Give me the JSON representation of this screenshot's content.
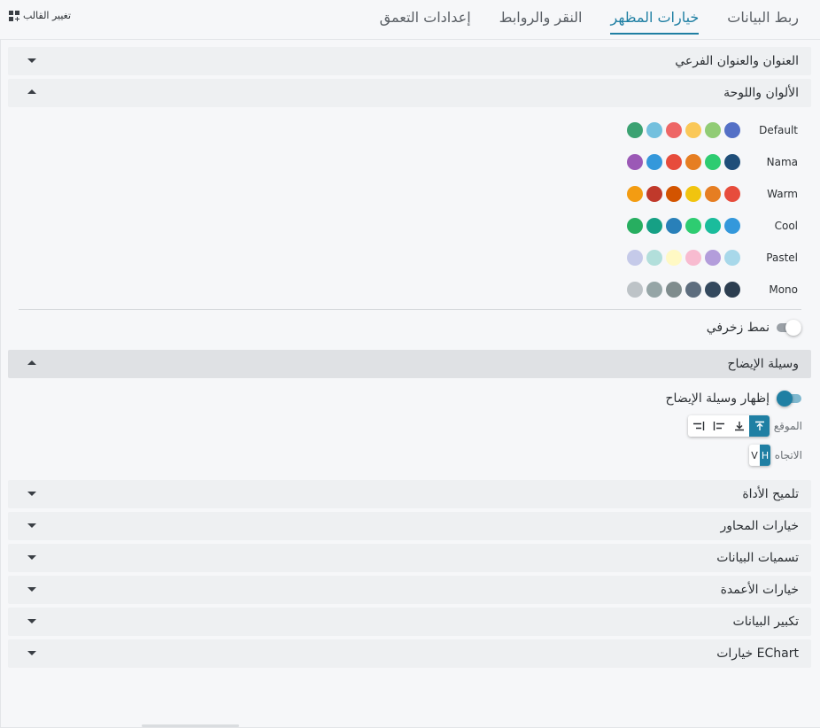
{
  "tabs": [
    {
      "label": "ربط البيانات",
      "active": false
    },
    {
      "label": "خيارات المظهر",
      "active": true
    },
    {
      "label": "النقر والروابط",
      "active": false
    },
    {
      "label": "إعدادات التعمق",
      "active": false
    }
  ],
  "change_template": {
    "label": "تغيير القالب",
    "icon": "grid-add-icon"
  },
  "sections": {
    "title_subtitle": {
      "label": "العنوان والعنوان الفرعي",
      "expanded": false
    },
    "colors_palette": {
      "label": "الألوان واللوحة",
      "expanded": true
    },
    "legend": {
      "label": "وسيلة الإيضاح",
      "expanded": true
    },
    "tooltip": {
      "label": "تلميح الأداة",
      "expanded": false
    },
    "axis_options": {
      "label": "خيارات المحاور",
      "expanded": false
    },
    "data_labels": {
      "label": "تسميات البيانات",
      "expanded": false
    },
    "column_options": {
      "label": "خيارات الأعمدة",
      "expanded": false
    },
    "data_zoom": {
      "label": "تكبير البيانات",
      "expanded": false
    },
    "echart_options": {
      "label": "خيارات EChart",
      "expanded": false
    }
  },
  "palettes": [
    {
      "name": "Default",
      "colors": [
        "#3ba272",
        "#73c0de",
        "#ee6666",
        "#fac858",
        "#91cc75",
        "#5470c6"
      ]
    },
    {
      "name": "Nama",
      "colors": [
        "#9b59b6",
        "#3498db",
        "#e74c3c",
        "#e67e22",
        "#2ecc71",
        "#1f4e79"
      ]
    },
    {
      "name": "Warm",
      "colors": [
        "#f39c12",
        "#c0392b",
        "#d35400",
        "#f1c40f",
        "#e67e22",
        "#e74c3c"
      ]
    },
    {
      "name": "Cool",
      "colors": [
        "#27ae60",
        "#16a085",
        "#2980b9",
        "#2ecc71",
        "#1abc9c",
        "#3498db"
      ]
    },
    {
      "name": "Pastel",
      "colors": [
        "#c5cae9",
        "#b2dfdb",
        "#fff9c4",
        "#f8bbd0",
        "#b39ddb",
        "#a8d8ea"
      ]
    },
    {
      "name": "Mono",
      "colors": [
        "#bdc3c7",
        "#95a5a6",
        "#7f8c8d",
        "#5d6d7e",
        "#34495e",
        "#2c3e50"
      ]
    }
  ],
  "decorative_pattern": {
    "label": "نمط زخرفي",
    "enabled": false
  },
  "legend": {
    "show_label": "إظهار وسيلة الإيضاح",
    "show_enabled": true,
    "position_label": "الموقع",
    "position_options": [
      "arrow-up-icon",
      "arrow-down-icon",
      "align-left-icon",
      "align-right-icon"
    ],
    "position_selected": "arrow-up-icon",
    "orientation_label": "الاتجاه",
    "orientation_options": [
      "H",
      "V"
    ],
    "orientation_selected": "H"
  },
  "colors": {
    "accent": "#1f7fa3",
    "header_bg": "#eef0f2",
    "header_active_bg": "#dfe1e4"
  }
}
